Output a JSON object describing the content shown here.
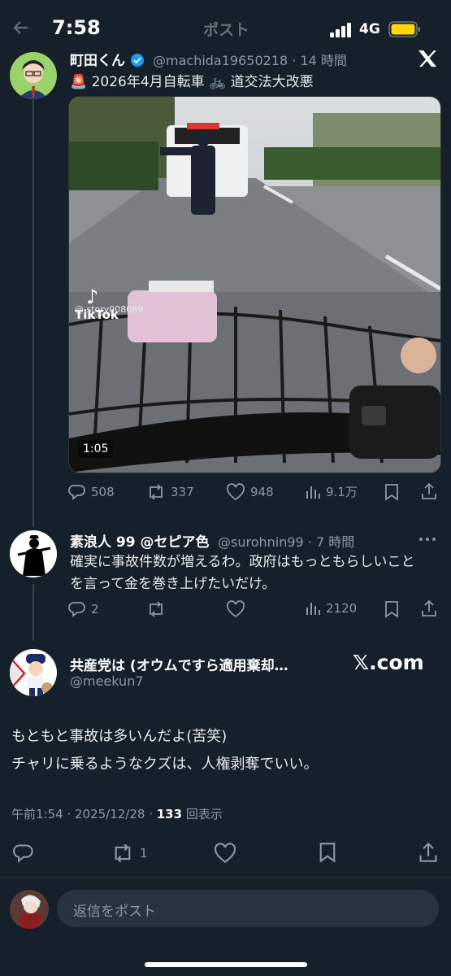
{
  "status_bar": {
    "time": "7:58",
    "network": "4G",
    "battery_color": "#ffd60a"
  },
  "nav": {
    "title": "ポスト"
  },
  "quoted_post": {
    "author_name": "町田くん",
    "handle": "@machida19650218 · 14 時間",
    "text": "🚨 2026年4月自転車 🚲 道交法大改悪",
    "video": {
      "duration": "1:05",
      "watermark": "TikTok",
      "watermark_user": "@ story008069"
    },
    "stats": {
      "replies": "508",
      "reposts": "337",
      "likes": "948",
      "views": "9.1万"
    }
  },
  "reply": {
    "author_name": "素浪人 99 @セピア色",
    "handle": "@surohnin99 · 7 時間",
    "text": "確実に事故件数が増えるわ。政府はもっともらしいことを言って金を巻き上げたいだけ。",
    "stats": {
      "replies": "2",
      "reposts": "",
      "likes": "",
      "views": "2120"
    }
  },
  "main_post": {
    "author_name": "共産党は (オウムですら適用棄却…",
    "handle": "@meekun7",
    "source_badge": "𝕏.com",
    "text_line1": "もともと事故は多いんだよ(苦笑)",
    "text_line2": "チャリに乗るようなクズは、人権剥奪でいい。",
    "timestamp": "午前1:54 · 2025/12/28 · ",
    "view_count": "133",
    "view_label": " 回表示",
    "stats": {
      "replies": "",
      "reposts": "1",
      "likes": ""
    }
  },
  "composer": {
    "placeholder": "返信をポスト"
  },
  "colors": {
    "background": "#15202b",
    "text": "#e7e9ea",
    "muted": "#8b98a5",
    "verified": "#1d9bf0"
  }
}
